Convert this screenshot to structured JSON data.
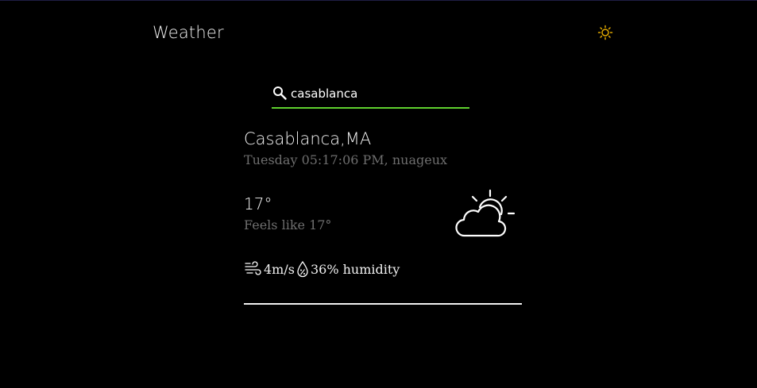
{
  "header": {
    "app_title": "Weather",
    "theme_icon": "sun-icon",
    "theme_icon_color": "#e0a800"
  },
  "search": {
    "icon": "search-icon",
    "value": "casablanca",
    "accent_color": "#5fd12e"
  },
  "weather": {
    "city": "Casablanca,MA",
    "datetime_description": "Tuesday 05:17:06 PM, nuageux",
    "temperature": "17°",
    "feels_like": "Feels like 17°",
    "condition_icon": "partly-cloudy-icon",
    "wind_icon": "wind-icon",
    "wind": "4m/s",
    "humidity_icon": "humidity-drop-icon",
    "humidity": "36% humidity"
  }
}
